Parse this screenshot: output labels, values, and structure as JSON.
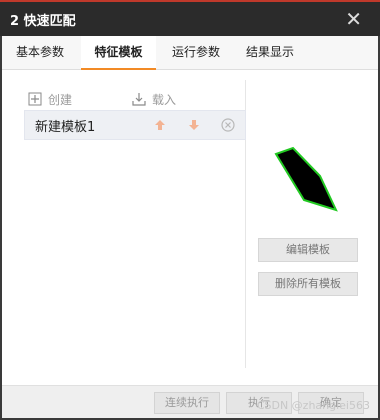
{
  "window": {
    "title": "2 快速匹配",
    "close_glyph": "✕"
  },
  "tabs": [
    {
      "label": "基本参数"
    },
    {
      "label": "特征模板"
    },
    {
      "label": "运行参数"
    },
    {
      "label": "结果显示"
    }
  ],
  "toolbar": {
    "create_label": "创建",
    "load_label": "载入"
  },
  "template_list": [
    {
      "name": "新建模板1"
    }
  ],
  "side_buttons": {
    "edit_label": "编辑模板",
    "delete_all_label": "删除所有模板"
  },
  "footer": {
    "continuous_label": "连续执行",
    "execute_label": "执行",
    "confirm_label": "确定",
    "watermark": "CSDN @zhanglei563"
  },
  "colors": {
    "accent": "#f28a25",
    "titlebar": "#2b2b2b",
    "preview_shape": "#000000",
    "preview_outline": "#22c922"
  },
  "icons": {
    "create": "plus-box-icon",
    "load": "download-icon",
    "move_up": "arrow-up-icon",
    "move_down": "arrow-down-icon",
    "delete": "delete-circle-icon"
  }
}
